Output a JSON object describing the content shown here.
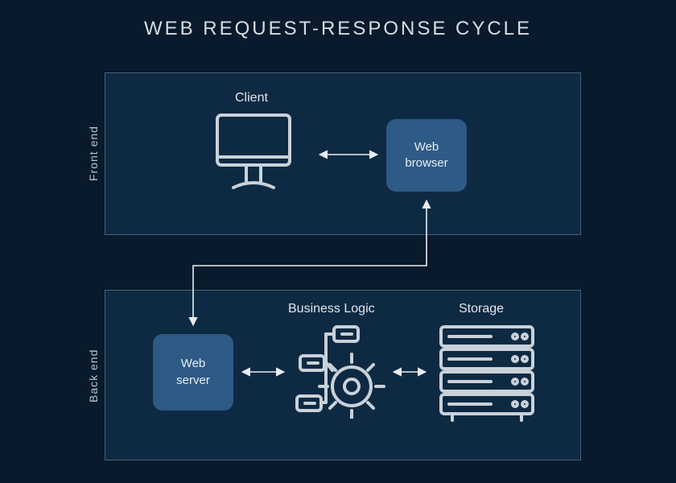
{
  "title": "WEB REQUEST-RESPONSE CYCLE",
  "sections": {
    "front": "Front end",
    "back": "Back end"
  },
  "nodes": {
    "client_label": "Client",
    "web_browser_line1": "Web",
    "web_browser_line2": "browser",
    "web_server_line1": "Web",
    "web_server_line2": "server",
    "business_logic_label": "Business Logic",
    "storage_label": "Storage"
  },
  "colors": {
    "background": "#081a2b",
    "panel": "#0e2a43",
    "panel_border": "#46637a",
    "node": "#2e5a86",
    "icon_stroke": "#c9d1d9",
    "text": "#d6dde2"
  }
}
